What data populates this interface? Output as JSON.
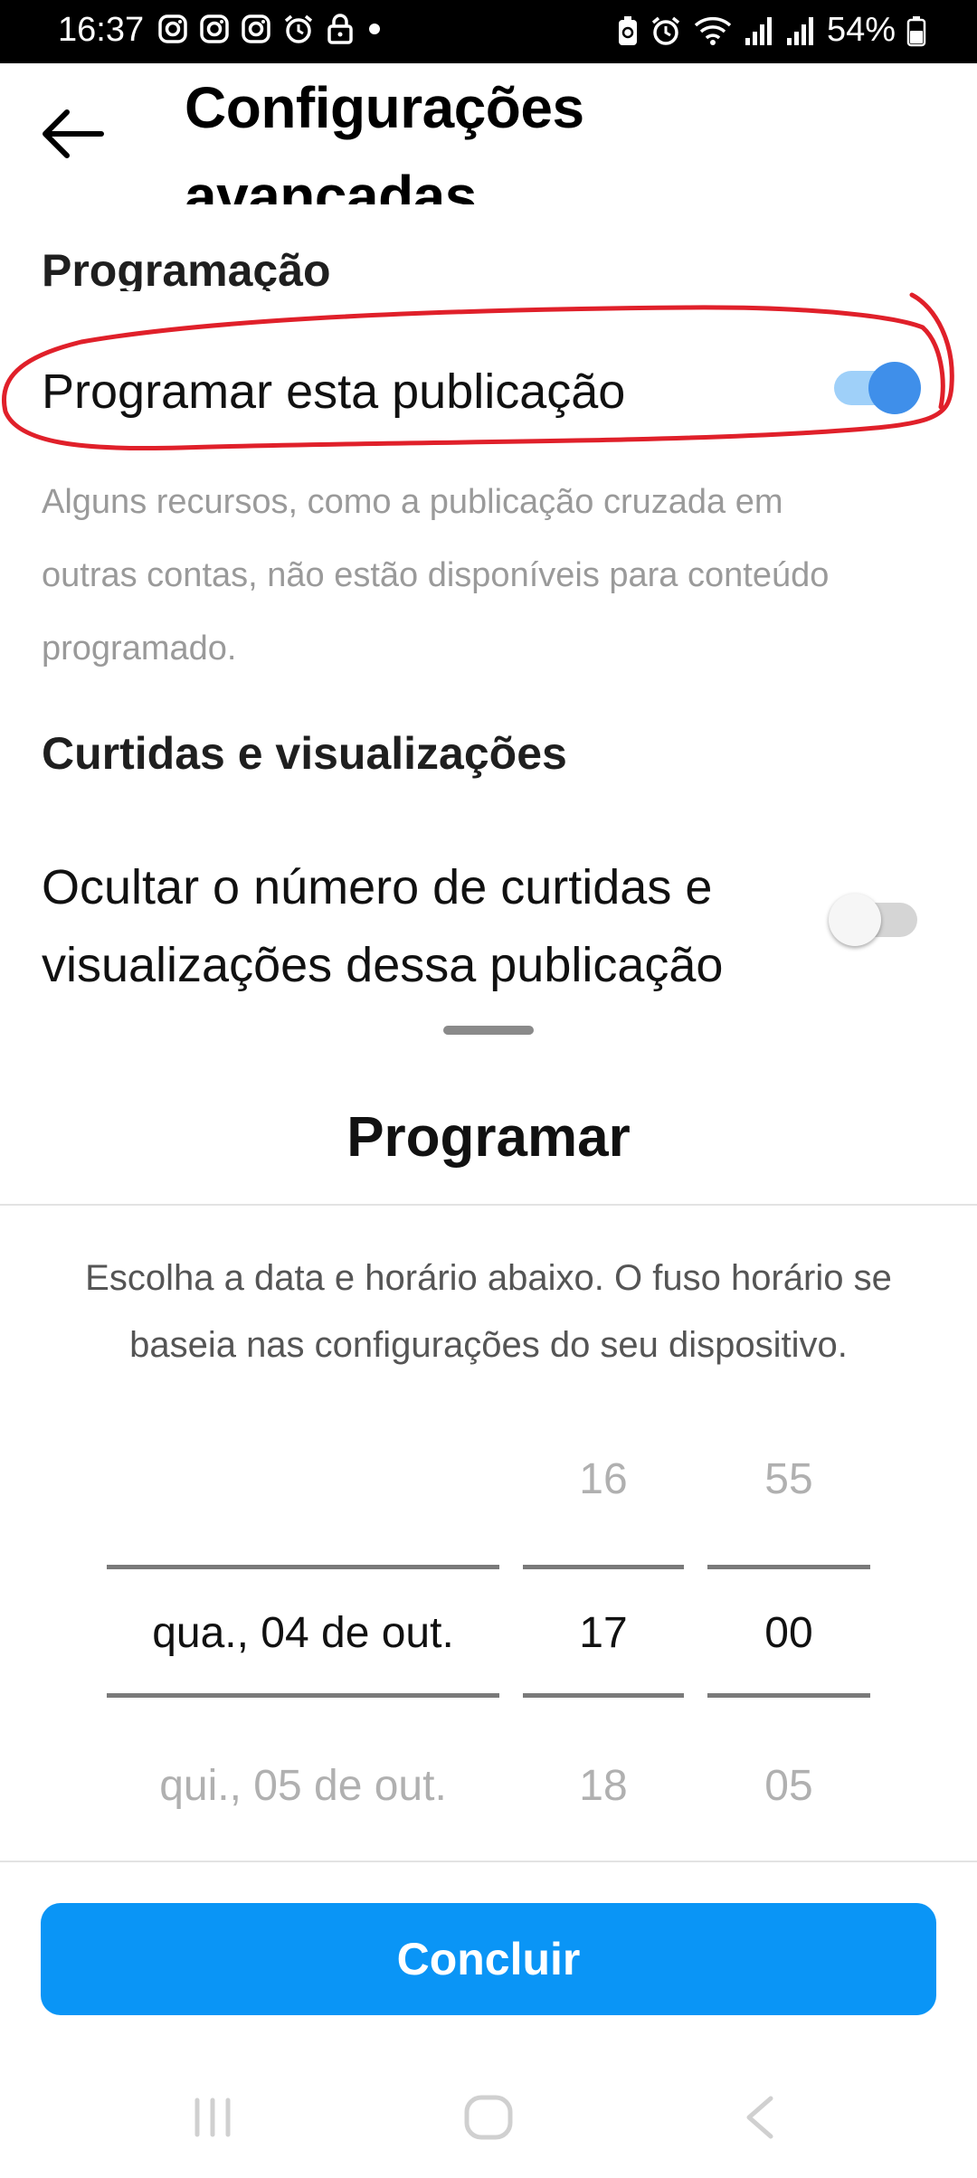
{
  "status_bar": {
    "time": "16:37",
    "battery_percent": "54%",
    "icons_left": [
      "instagram-icon",
      "instagram-icon",
      "instagram-icon",
      "alarm-icon",
      "lock-icon",
      "dot-icon"
    ],
    "icons_right": [
      "battery-saver-icon",
      "alarm-icon",
      "wifi-icon",
      "signal-icon",
      "signal-icon",
      "battery-icon"
    ]
  },
  "header": {
    "title": "Configurações avançadas",
    "back_icon": "arrow-left-icon"
  },
  "scheduling_section": {
    "title": "Programação",
    "toggle_label": "Programar esta publicação",
    "toggle_on": true,
    "description": "Alguns recursos, como a publicação cruzada em outras contas, não estão disponíveis para conteúdo programado."
  },
  "likes_section": {
    "title": "Curtidas e visualizações",
    "toggle_label": "Ocultar o número de curtidas e visualizações dessa publicação",
    "toggle_on": false
  },
  "sheet": {
    "title": "Programar",
    "description": "Escolha a data e horário abaixo. O fuso horário se baseia nas configurações do seu dispositivo.",
    "picker": {
      "dates": [
        "",
        "qua., 04 de out.",
        "qui., 05 de out."
      ],
      "hours": [
        "16",
        "17",
        "18"
      ],
      "minutes": [
        "55",
        "00",
        "05"
      ],
      "selected": {
        "date": "qua., 04 de out.",
        "hour": "17",
        "minute": "00"
      }
    },
    "done_label": "Concluir"
  },
  "colors": {
    "accent": "#0a95f6",
    "toggle_on_knob": "#3f8fea",
    "toggle_on_track": "#9fd0f9",
    "annotation": "#e0202a"
  },
  "nav_bar": {
    "icons": [
      "recent-apps-icon",
      "home-icon",
      "back-icon"
    ]
  }
}
